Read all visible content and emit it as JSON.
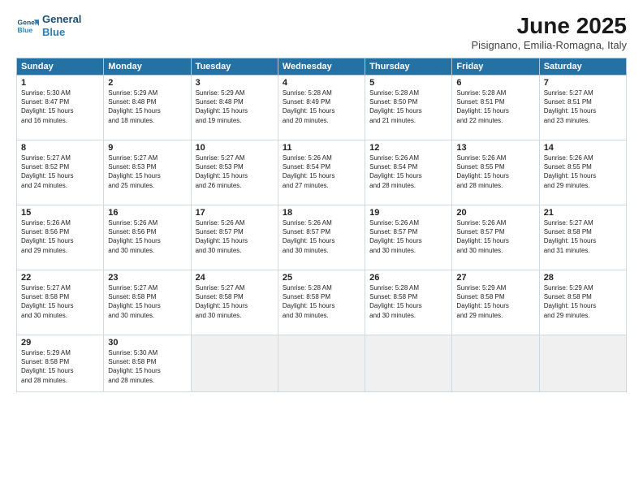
{
  "logo": {
    "line1": "General",
    "line2": "Blue"
  },
  "title": "June 2025",
  "subtitle": "Pisignano, Emilia-Romagna, Italy",
  "weekdays": [
    "Sunday",
    "Monday",
    "Tuesday",
    "Wednesday",
    "Thursday",
    "Friday",
    "Saturday"
  ],
  "weeks": [
    [
      {
        "day": "1",
        "info": "Sunrise: 5:30 AM\nSunset: 8:47 PM\nDaylight: 15 hours\nand 16 minutes."
      },
      {
        "day": "2",
        "info": "Sunrise: 5:29 AM\nSunset: 8:48 PM\nDaylight: 15 hours\nand 18 minutes."
      },
      {
        "day": "3",
        "info": "Sunrise: 5:29 AM\nSunset: 8:48 PM\nDaylight: 15 hours\nand 19 minutes."
      },
      {
        "day": "4",
        "info": "Sunrise: 5:28 AM\nSunset: 8:49 PM\nDaylight: 15 hours\nand 20 minutes."
      },
      {
        "day": "5",
        "info": "Sunrise: 5:28 AM\nSunset: 8:50 PM\nDaylight: 15 hours\nand 21 minutes."
      },
      {
        "day": "6",
        "info": "Sunrise: 5:28 AM\nSunset: 8:51 PM\nDaylight: 15 hours\nand 22 minutes."
      },
      {
        "day": "7",
        "info": "Sunrise: 5:27 AM\nSunset: 8:51 PM\nDaylight: 15 hours\nand 23 minutes."
      }
    ],
    [
      {
        "day": "8",
        "info": "Sunrise: 5:27 AM\nSunset: 8:52 PM\nDaylight: 15 hours\nand 24 minutes."
      },
      {
        "day": "9",
        "info": "Sunrise: 5:27 AM\nSunset: 8:53 PM\nDaylight: 15 hours\nand 25 minutes."
      },
      {
        "day": "10",
        "info": "Sunrise: 5:27 AM\nSunset: 8:53 PM\nDaylight: 15 hours\nand 26 minutes."
      },
      {
        "day": "11",
        "info": "Sunrise: 5:26 AM\nSunset: 8:54 PM\nDaylight: 15 hours\nand 27 minutes."
      },
      {
        "day": "12",
        "info": "Sunrise: 5:26 AM\nSunset: 8:54 PM\nDaylight: 15 hours\nand 28 minutes."
      },
      {
        "day": "13",
        "info": "Sunrise: 5:26 AM\nSunset: 8:55 PM\nDaylight: 15 hours\nand 28 minutes."
      },
      {
        "day": "14",
        "info": "Sunrise: 5:26 AM\nSunset: 8:55 PM\nDaylight: 15 hours\nand 29 minutes."
      }
    ],
    [
      {
        "day": "15",
        "info": "Sunrise: 5:26 AM\nSunset: 8:56 PM\nDaylight: 15 hours\nand 29 minutes."
      },
      {
        "day": "16",
        "info": "Sunrise: 5:26 AM\nSunset: 8:56 PM\nDaylight: 15 hours\nand 30 minutes."
      },
      {
        "day": "17",
        "info": "Sunrise: 5:26 AM\nSunset: 8:57 PM\nDaylight: 15 hours\nand 30 minutes."
      },
      {
        "day": "18",
        "info": "Sunrise: 5:26 AM\nSunset: 8:57 PM\nDaylight: 15 hours\nand 30 minutes."
      },
      {
        "day": "19",
        "info": "Sunrise: 5:26 AM\nSunset: 8:57 PM\nDaylight: 15 hours\nand 30 minutes."
      },
      {
        "day": "20",
        "info": "Sunrise: 5:26 AM\nSunset: 8:57 PM\nDaylight: 15 hours\nand 30 minutes."
      },
      {
        "day": "21",
        "info": "Sunrise: 5:27 AM\nSunset: 8:58 PM\nDaylight: 15 hours\nand 31 minutes."
      }
    ],
    [
      {
        "day": "22",
        "info": "Sunrise: 5:27 AM\nSunset: 8:58 PM\nDaylight: 15 hours\nand 30 minutes."
      },
      {
        "day": "23",
        "info": "Sunrise: 5:27 AM\nSunset: 8:58 PM\nDaylight: 15 hours\nand 30 minutes."
      },
      {
        "day": "24",
        "info": "Sunrise: 5:27 AM\nSunset: 8:58 PM\nDaylight: 15 hours\nand 30 minutes."
      },
      {
        "day": "25",
        "info": "Sunrise: 5:28 AM\nSunset: 8:58 PM\nDaylight: 15 hours\nand 30 minutes."
      },
      {
        "day": "26",
        "info": "Sunrise: 5:28 AM\nSunset: 8:58 PM\nDaylight: 15 hours\nand 30 minutes."
      },
      {
        "day": "27",
        "info": "Sunrise: 5:29 AM\nSunset: 8:58 PM\nDaylight: 15 hours\nand 29 minutes."
      },
      {
        "day": "28",
        "info": "Sunrise: 5:29 AM\nSunset: 8:58 PM\nDaylight: 15 hours\nand 29 minutes."
      }
    ],
    [
      {
        "day": "29",
        "info": "Sunrise: 5:29 AM\nSunset: 8:58 PM\nDaylight: 15 hours\nand 28 minutes."
      },
      {
        "day": "30",
        "info": "Sunrise: 5:30 AM\nSunset: 8:58 PM\nDaylight: 15 hours\nand 28 minutes."
      },
      {
        "day": "",
        "info": ""
      },
      {
        "day": "",
        "info": ""
      },
      {
        "day": "",
        "info": ""
      },
      {
        "day": "",
        "info": ""
      },
      {
        "day": "",
        "info": ""
      }
    ]
  ]
}
